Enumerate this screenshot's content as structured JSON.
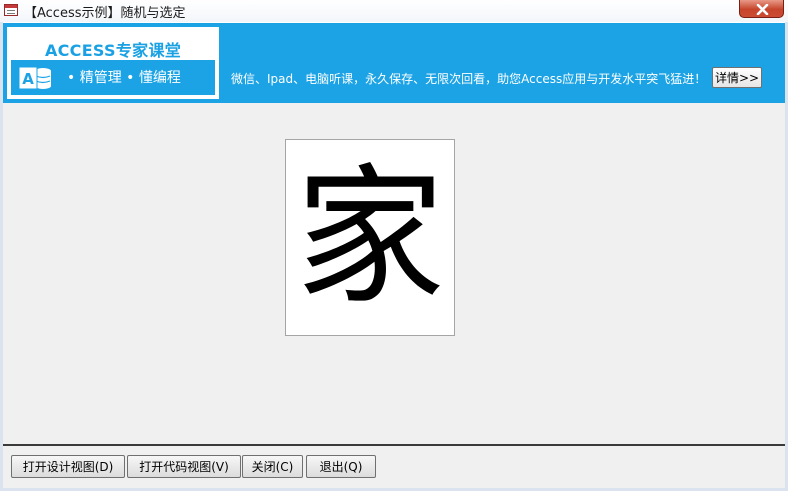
{
  "window": {
    "title": "【Access示例】随机与选定"
  },
  "banner": {
    "brand_title": "ACCESS专家课堂",
    "brand_slogan": "•  精管理  •  懂编程",
    "ad_text": "微信、Ipad、电脑听课，永久保存、无限次回看，助您Access应用与开发水平突飞猛进！",
    "detail_label": "详情>>",
    "colors": {
      "banner": "#1ba3e6",
      "brand_text": "#1aa1e4"
    }
  },
  "display": {
    "character": "家"
  },
  "footer": {
    "buttons": [
      {
        "label": "打开设计视图(D)"
      },
      {
        "label": "打开代码视图(V)"
      },
      {
        "label": "关闭(C)"
      },
      {
        "label": "退出(Q)"
      }
    ]
  },
  "icons": {
    "app": "access-form-icon",
    "close": "close-icon",
    "logo": "access-logo-icon"
  }
}
